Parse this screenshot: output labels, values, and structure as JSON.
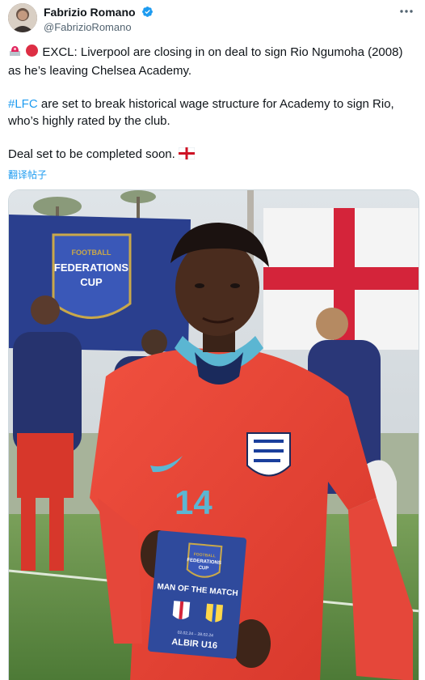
{
  "author": {
    "display_name": "Fabrizio Romano",
    "handle": "@FabrizioRomano",
    "verified": true
  },
  "icons": {
    "verified": "verified-badge-icon",
    "more": "more-options-icon",
    "siren": "police-light-icon",
    "red_circle": "red-circle-icon",
    "flag": "england-flag-icon"
  },
  "tweet": {
    "line1": "EXCL: Liverpool are closing in on deal to sign Rio Ngumoha (2008) as he’s leaving Chelsea Academy.",
    "hashtag": "#LFC",
    "line2_rest": " are set to break historical wage structure for Academy to sign Rio, who’s highly rated by the club.",
    "line3": "Deal set to be completed soon."
  },
  "translate_label": "翻译帖子",
  "photo": {
    "banner_lines": [
      "FOOTBALL",
      "FEDERATIONS",
      "CUP"
    ],
    "shirt_number": "14",
    "card_lines": [
      "FOOTBALL",
      "FEDERATIONS",
      "CUP"
    ],
    "card_title": "MAN OF THE MATCH",
    "card_dates": "02.02.24 – 28.02.24",
    "card_team": "ALBIR U16"
  },
  "colors": {
    "accent": "#1d9bf0",
    "text": "#0f1419",
    "secondary": "#536471"
  }
}
